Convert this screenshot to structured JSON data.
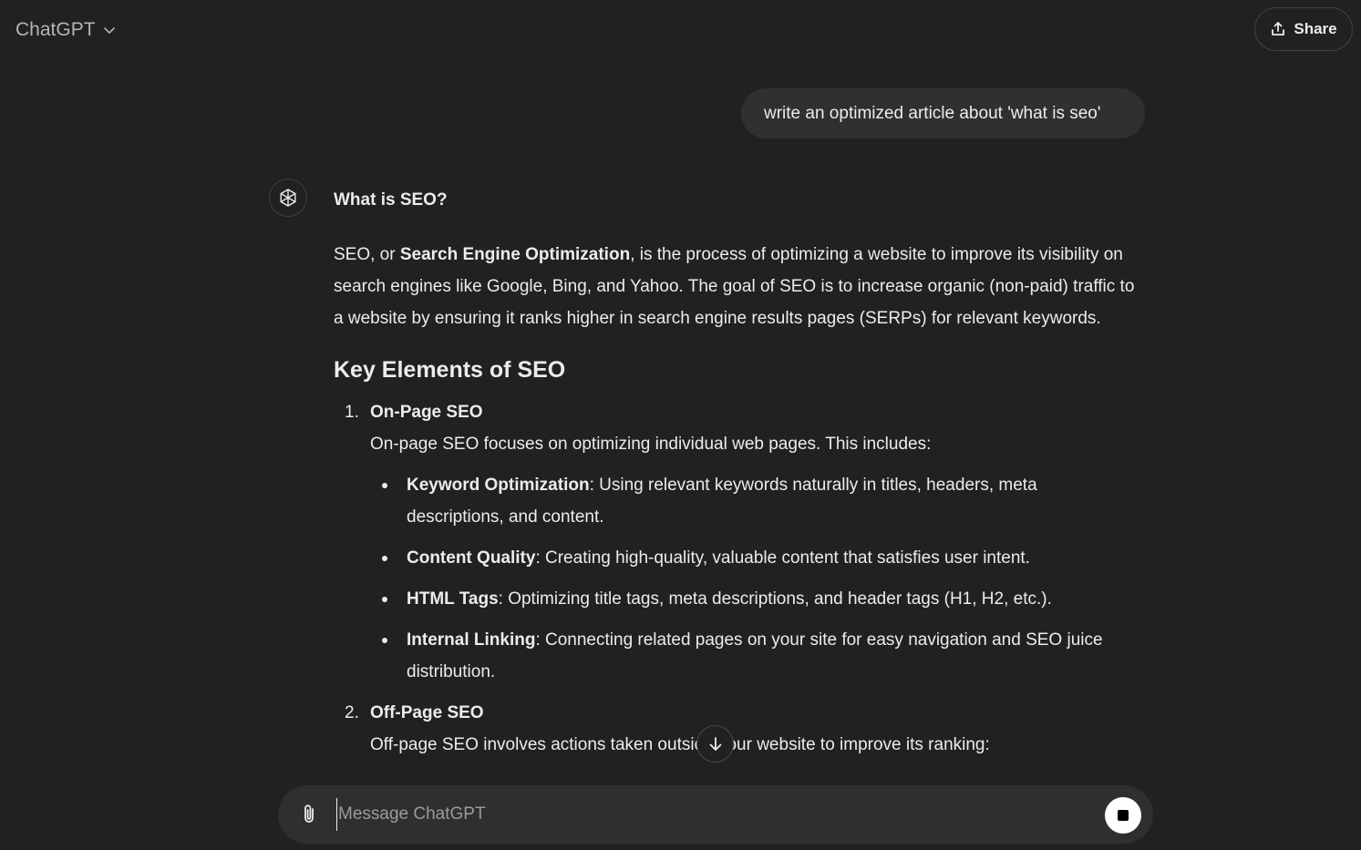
{
  "header": {
    "model_name": "ChatGPT",
    "model_chevron_icon": "chevron-down-icon",
    "share_label": "Share",
    "share_icon": "share-upload-icon"
  },
  "conversation": {
    "user_message": "write an optimized article about 'what is seo'",
    "assistant": {
      "avatar_icon": "openai-logo-icon",
      "title": "What is SEO?",
      "intro_prefix": "SEO, or ",
      "intro_bold": "Search Engine Optimization",
      "intro_suffix": ", is the process of optimizing a website to improve its visibility on search engines like Google, Bing, and Yahoo. The goal of SEO is to increase organic (non-paid) traffic to a website by ensuring it ranks higher in search engine results pages (SERPs) for relevant keywords.",
      "section_heading": "Key Elements of SEO",
      "sections": [
        {
          "number": "1.",
          "title": "On-Page SEO",
          "description": "On-page SEO focuses on optimizing individual web pages. This includes:",
          "bullets": [
            {
              "term": "Keyword Optimization",
              "text": ": Using relevant keywords naturally in titles, headers, meta descriptions, and content."
            },
            {
              "term": "Content Quality",
              "text": ": Creating high-quality, valuable content that satisfies user intent."
            },
            {
              "term": "HTML Tags",
              "text": ": Optimizing title tags, meta descriptions, and header tags (H1, H2, etc.)."
            },
            {
              "term": "Internal Linking",
              "text": ": Connecting related pages on your site for easy navigation and SEO juice distribution."
            }
          ]
        },
        {
          "number": "2.",
          "title": "Off-Page SEO",
          "description": "Off-page SEO involves actions taken outside your website to improve its ranking:"
        }
      ]
    }
  },
  "scroll_button_icon": "arrow-down-icon",
  "composer": {
    "placeholder": "Message ChatGPT",
    "value": "",
    "attach_icon": "paperclip-icon",
    "stop_icon": "stop-square-icon"
  },
  "colors": {
    "background": "#212121",
    "bubble": "#303030",
    "composer": "#2f2f2f",
    "text": "#ececec",
    "muted": "#b4b4b4"
  }
}
